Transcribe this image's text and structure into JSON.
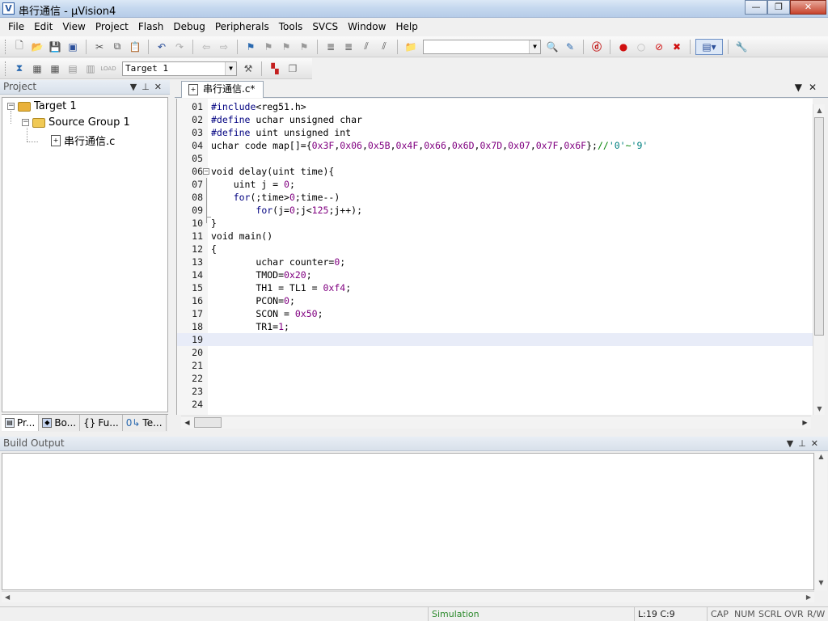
{
  "window": {
    "title": "串行通信 - µVision4",
    "app_icon": "V"
  },
  "menu": [
    "File",
    "Edit",
    "View",
    "Project",
    "Flash",
    "Debug",
    "Peripherals",
    "Tools",
    "SVCS",
    "Window",
    "Help"
  ],
  "toolbar2": {
    "target_combo": "Target 1"
  },
  "project_panel": {
    "title": "Project",
    "tree": {
      "target": "Target 1",
      "group": "Source Group 1",
      "file": "串行通信.c"
    },
    "tabs": [
      "Pr...",
      "Bo...",
      "Fu...",
      "Te..."
    ]
  },
  "editor": {
    "tab_label": "串行通信.c*",
    "current_line": 19,
    "lines": [
      "01",
      "02",
      "03",
      "04",
      "05",
      "06",
      "07",
      "08",
      "09",
      "10",
      "11",
      "12",
      "13",
      "14",
      "15",
      "16",
      "17",
      "18",
      "19",
      "20",
      "21",
      "22",
      "23",
      "24"
    ]
  },
  "build_output": {
    "title": "Build Output"
  },
  "statusbar": {
    "mode": "Simulation",
    "position": "L:19 C:9",
    "indicators": [
      "CAP",
      "NUM",
      "SCRL",
      "OVR",
      "R/W"
    ]
  },
  "colors": {
    "keyword": "#000080",
    "number": "#800080",
    "comment": "#008000",
    "char": "#008080",
    "simulation": "#2e8b2e"
  }
}
